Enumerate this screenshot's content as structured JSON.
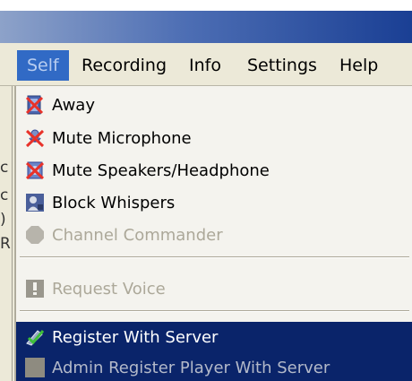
{
  "menubar": {
    "items": [
      {
        "label": "Self",
        "active": true
      },
      {
        "label": "Recording",
        "active": false
      },
      {
        "label": "Info",
        "active": false
      },
      {
        "label": "Settings",
        "active": false
      },
      {
        "label": "Help",
        "active": false
      }
    ]
  },
  "left_panel_fragments": [
    "c",
    "c",
    ")",
    "R"
  ],
  "self_menu": {
    "items": [
      {
        "label": "Away",
        "icon": "away-icon",
        "enabled": true,
        "highlighted": false
      },
      {
        "label": "Mute Microphone",
        "icon": "mute-microphone-icon",
        "enabled": true,
        "highlighted": false
      },
      {
        "label": "Mute Speakers/Headphone",
        "icon": "mute-speakers-icon",
        "enabled": true,
        "highlighted": false
      },
      {
        "label": "Block Whispers",
        "icon": "block-whispers-icon",
        "enabled": true,
        "highlighted": false
      },
      {
        "label": "Channel Commander",
        "icon": "channel-commander-icon",
        "enabled": false,
        "highlighted": false
      },
      {
        "label": "Request Voice",
        "icon": "request-voice-icon",
        "enabled": false,
        "highlighted": false
      },
      {
        "label": "Register With Server",
        "icon": "register-icon",
        "enabled": true,
        "highlighted": true
      },
      {
        "label": "Admin Register Player With Server",
        "icon": "admin-register-icon",
        "enabled": false,
        "highlighted": true
      }
    ]
  },
  "colors": {
    "menu_highlight": "#0a246a",
    "menubar_active": "#316ac5",
    "menu_background": "#f4f3ee",
    "disabled_text": "#aca899"
  }
}
